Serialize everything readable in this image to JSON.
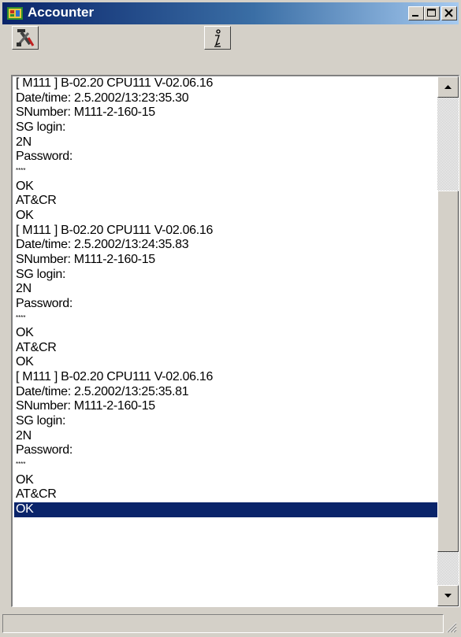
{
  "window": {
    "title": "Accounter",
    "icon": "accounter-app-icon"
  },
  "titlebar_buttons": [
    {
      "name": "minimize-button",
      "glyph": "_"
    },
    {
      "name": "maximize-button",
      "glyph": "□"
    },
    {
      "name": "close-button",
      "glyph": "×"
    }
  ],
  "toolbar": [
    {
      "name": "settings-tool-button",
      "icon": "tools-icon"
    },
    {
      "name": "info-tool-button",
      "icon": "info-icon"
    }
  ],
  "log": {
    "lines": [
      "[ M111 ]  B-02.20  CPU111  V-02.06.16",
      "Date/time: 2.5.2002/13:23:35.30",
      "SNumber: M111-2-160-15",
      "SG login:",
      "2N",
      "Password:",
      "****",
      "OK",
      "AT&CR",
      "OK",
      "[ M111 ]  B-02.20  CPU111  V-02.06.16",
      "Date/time: 2.5.2002/13:24:35.83",
      "SNumber: M111-2-160-15",
      "SG login:",
      "2N",
      "Password:",
      "****",
      "OK",
      "AT&CR",
      "OK",
      "[ M111 ]  B-02.20  CPU111  V-02.06.16",
      "Date/time: 2.5.2002/13:25:35.81",
      "SNumber: M111-2-160-15",
      "SG login:",
      "2N",
      "Password:",
      "****",
      "OK",
      "AT&CR",
      "OK"
    ],
    "selected_index": 29,
    "scroll_position": 0.74
  },
  "statusbar": {
    "text": ""
  },
  "colors": {
    "title_start": "#0a246a",
    "title_end": "#a6caf0",
    "selection": "#0a246a",
    "face": "#d4d0c8"
  }
}
